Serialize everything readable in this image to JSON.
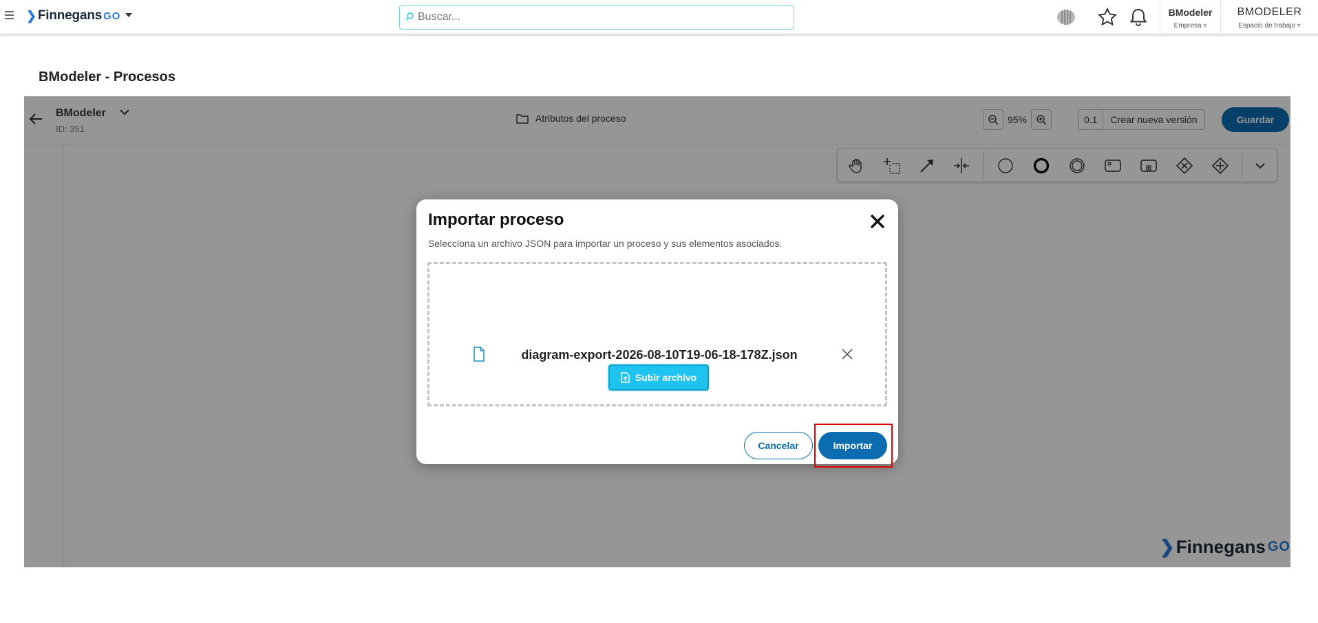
{
  "topbar": {
    "logo_text": "Finnegans",
    "logo_suffix": "GO",
    "search_placeholder": "Buscar...",
    "company": {
      "name": "BModeler",
      "label": "Empresa ▿"
    },
    "workspace": {
      "name": "BMODELER",
      "label": "Espacio de trabajo ▿"
    }
  },
  "page": {
    "title": "BModeler - Procesos"
  },
  "editor": {
    "process_name": "BModeler",
    "process_id": "ID: 351",
    "attributes_label": "Atributos del proceso",
    "zoom_value": "95%",
    "version_number": "0.1",
    "new_version_label": "Crear nueva versión",
    "save_label": "Guardar",
    "palette_tools": [
      "hand-tool-icon",
      "lasso-tool-icon",
      "connect-tool-icon",
      "space-tool-icon",
      "start-event-icon",
      "end-event-icon",
      "intermediate-event-icon",
      "task-icon",
      "subprocess-icon",
      "exclusive-gateway-icon",
      "parallel-gateway-icon",
      "chevron-down-icon"
    ],
    "watermark_text": "Finnegans",
    "watermark_suffix": "GO"
  },
  "modal": {
    "title": "Importar proceso",
    "description": "Selecciona un archivo JSON para importar un proceso y sus elementos asociados.",
    "file_name": "diagram-export-2026-08-10T19-06-18-178Z.json",
    "upload_label": "Subir archivo",
    "cancel_label": "Cancelar",
    "import_label": "Importar"
  },
  "colors": {
    "primary": "#0b6cb0",
    "upload": "#1ec3ef",
    "highlight": "#e00000",
    "overlay": "rgba(0,0,0,0.41)"
  }
}
